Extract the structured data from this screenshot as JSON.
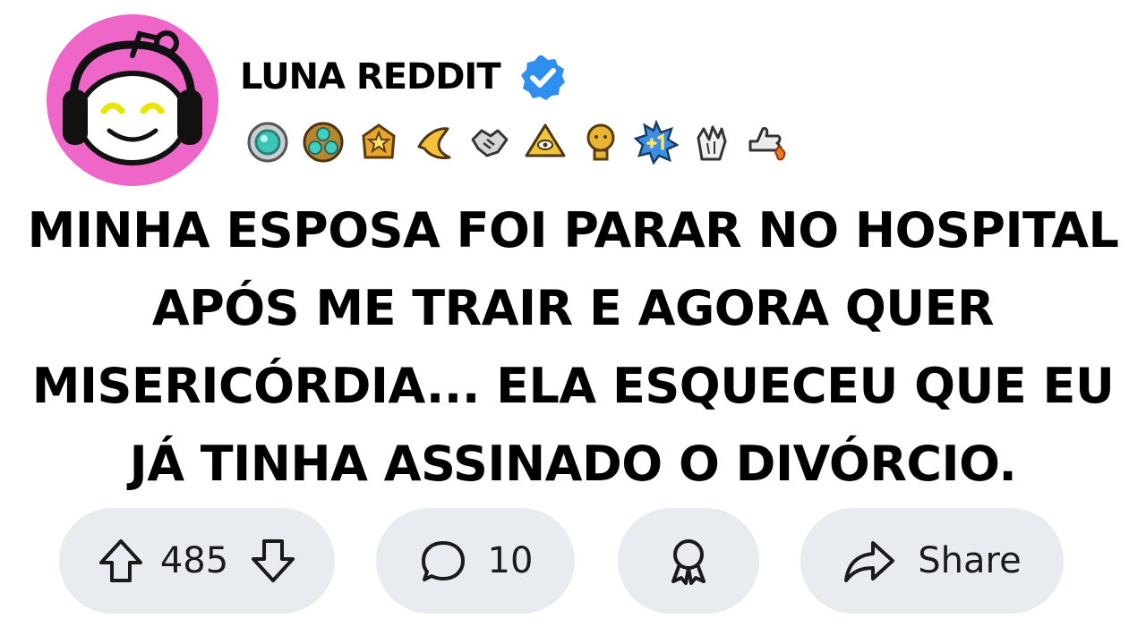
{
  "profile": {
    "username": "LUNA REDDIT",
    "verified": true,
    "avatar_icon": "snoo-headphones-icon",
    "avatar_bg": "#ee66c8",
    "badges": [
      "trophy-gem-icon",
      "gems-cluster-icon",
      "star-shield-icon",
      "banana-icon",
      "handshake-icon",
      "pyramid-eye-icon",
      "snoo-trophy-icon",
      "plus-one-icon",
      "clapping-hands-icon",
      "thumbs-up-fire-icon"
    ]
  },
  "post": {
    "title_lines": [
      "MINHA ESPOSA FOI PARAR NO HOSPITAL",
      "APÓS ME TRAIR E AGORA QUER",
      "MISERICÓRDIA... ELA ESQUECEU QUE EU",
      "JÁ TINHA ASSINADO O DIVÓRCIO."
    ]
  },
  "actions": {
    "vote_count": "485",
    "comment_count": "10",
    "share_label": "Share",
    "pill_bg": "#e8ecf0",
    "verified_color": "#2f8ff0"
  }
}
